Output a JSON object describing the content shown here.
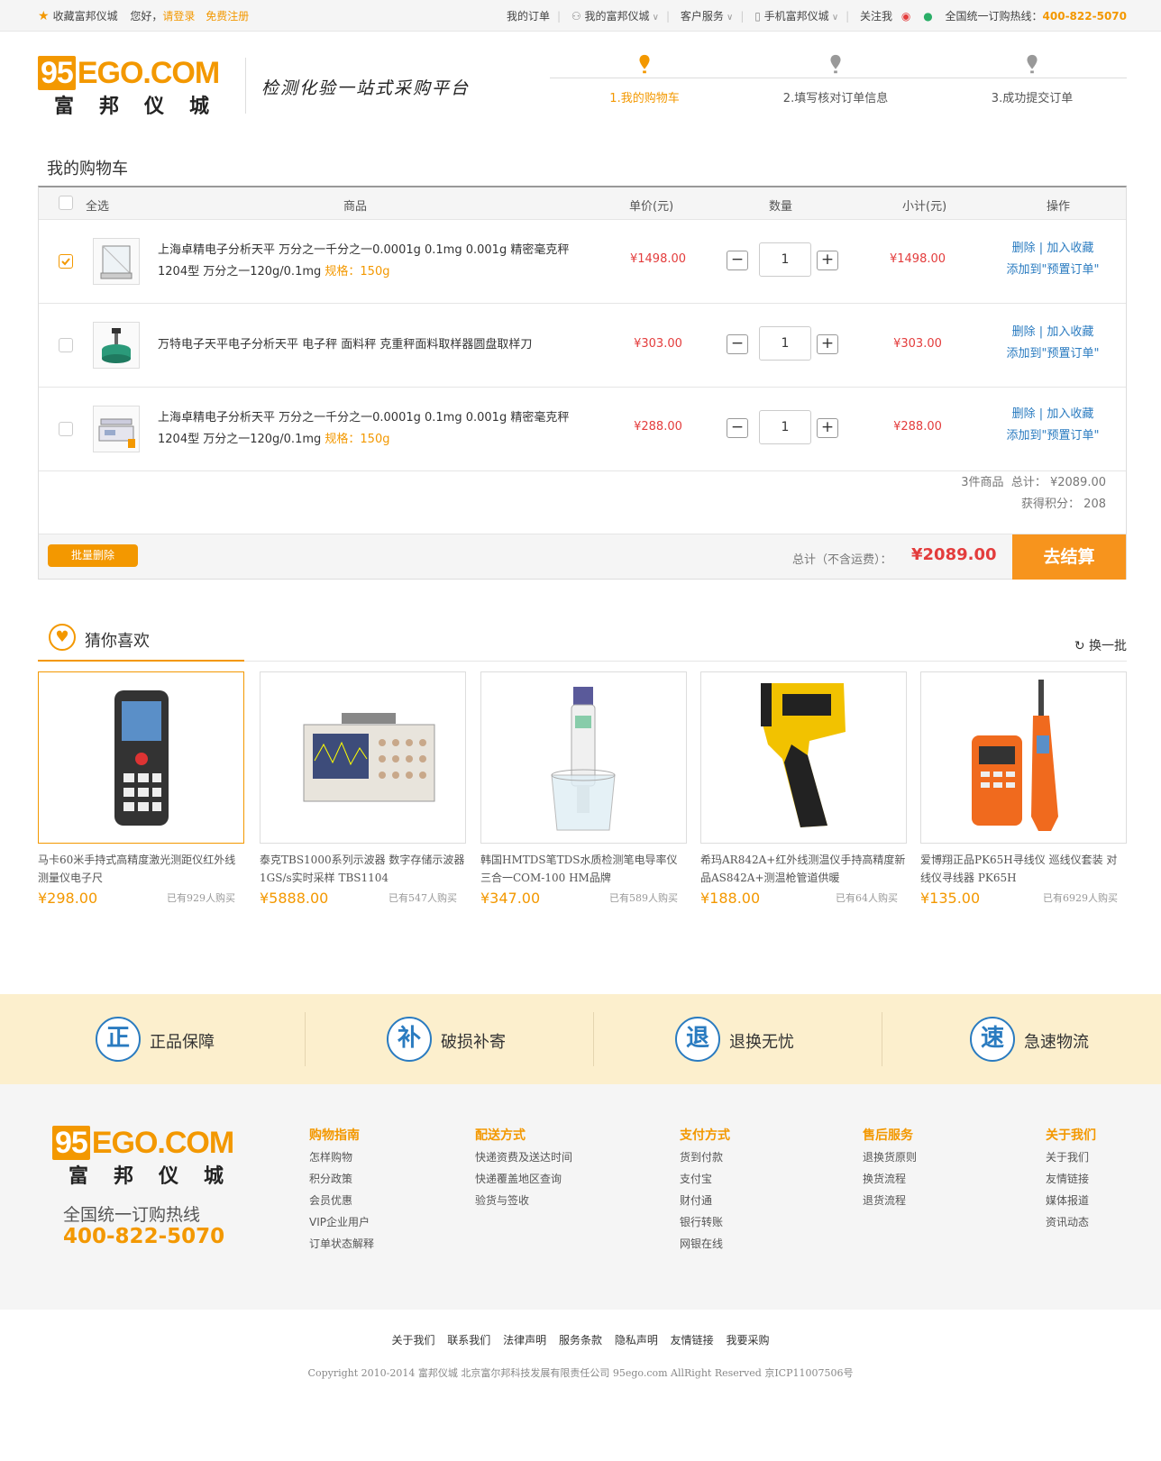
{
  "topbar": {
    "fav": "收藏富邦仪城",
    "hello": "您好，",
    "login": "请登录",
    "register": "免费注册",
    "nav": [
      "我的订单",
      "我的富邦仪城",
      "客户服务",
      "手机富邦仪城",
      "关注我"
    ],
    "hotline_label": "全国统一订购热线：",
    "hotline": "400-822-5070"
  },
  "header": {
    "logo_en": "95EGO.COM",
    "logo_n": "95",
    "logo_rest": "EGO.COM",
    "logo_cn": "富邦仪城",
    "slogan": "检测化验一站式采购平台",
    "steps": [
      "1.我的购物车",
      "2.填写核对订单信息",
      "3.成功提交订单"
    ]
  },
  "cart": {
    "title": "我的购物车",
    "headers": {
      "select_all": "全选",
      "product": "商品",
      "unit_price": "单价(元)",
      "qty": "数量",
      "subtotal": "小计(元)",
      "ops": "操作"
    },
    "items": [
      {
        "name": "上海卓精电子分析天平 万分之一千分之一0.0001g 0.1mg 0.001g 精密毫克秤 1204型 万分之一120g/0.1mg",
        "spec": "规格：150g",
        "price": "¥1498.00",
        "qty": "1",
        "subtotal": "¥1498.00",
        "checked": true
      },
      {
        "name": "万特电子天平电子分析天平 电子秤 面料秤 克重秤面料取样器圆盘取样刀",
        "spec": "",
        "price": "¥303.00",
        "qty": "1",
        "subtotal": "¥303.00",
        "checked": false
      },
      {
        "name": "上海卓精电子分析天平 万分之一千分之一0.0001g 0.1mg 0.001g 精密毫克秤 1204型 万分之一120g/0.1mg",
        "spec": "规格：150g",
        "price": "¥288.00",
        "qty": "1",
        "subtotal": "¥288.00",
        "checked": false
      }
    ],
    "ops": {
      "delete": "删除",
      "sep": "|",
      "fav": "加入收藏",
      "preset": "添加到\"预置订单\""
    },
    "summary": {
      "count": "3件商品",
      "total_lbl": "总计：",
      "total": "¥2089.00",
      "points_lbl": "获得积分：",
      "points": "208"
    },
    "batch_delete": "批量删除",
    "grand_lbl": "总计（不含运费）：",
    "grand": "¥2089.00",
    "checkout": "去结算"
  },
  "guess": {
    "title": "猜你喜欢",
    "refresh": "换一批",
    "items": [
      {
        "title": "马卡60米手持式高精度激光测距仪红外线测量仪电子尺",
        "price": "¥298.00",
        "bought": "已有929人购买"
      },
      {
        "title": "泰克TBS1000系列示波器 数字存储示波器1GS/s实时采样 TBS1104",
        "price": "¥5888.00",
        "bought": "已有547人购买"
      },
      {
        "title": "韩国HMTDS笔TDS水质检测笔电导率仪三合一COM-100 HM品牌",
        "price": "¥347.00",
        "bought": "已有589人购买"
      },
      {
        "title": "希玛AR842A+红外线测温仪手持高精度新品AS842A+测温枪管道供暖",
        "price": "¥188.00",
        "bought": "已有64人购买"
      },
      {
        "title": "爱博翔正品PK65H寻线仪 巡线仪套装 对线仪寻线器 PK65H",
        "price": "¥135.00",
        "bought": "已有6929人购买"
      }
    ]
  },
  "guarantee": [
    {
      "icon": "正",
      "label": "正品保障"
    },
    {
      "icon": "补",
      "label": "破损补寄"
    },
    {
      "icon": "退",
      "label": "退换无忧"
    },
    {
      "icon": "速",
      "label": "急速物流"
    }
  ],
  "footer": {
    "hotline_lbl": "全国统一订购热线",
    "hotline": "400-822-5070",
    "cols": [
      {
        "h": "购物指南",
        "items": [
          "怎样购物",
          "积分政策",
          "会员优惠",
          "VIP企业用户",
          "订单状态解释"
        ]
      },
      {
        "h": "配送方式",
        "items": [
          "快递资费及送达时间",
          "快递覆盖地区查询",
          "验货与签收"
        ]
      },
      {
        "h": "支付方式",
        "items": [
          "货到付款",
          "支付宝",
          "财付通",
          "银行转账",
          "网银在线"
        ]
      },
      {
        "h": "售后服务",
        "items": [
          "退换货原则",
          "换货流程",
          "退货流程"
        ]
      },
      {
        "h": "关于我们",
        "items": [
          "关于我们",
          "友情链接",
          "媒体报道",
          "资讯动态"
        ]
      }
    ],
    "links": [
      "关于我们",
      "联系我们",
      "法律声明",
      "服务条款",
      "隐私声明",
      "友情链接",
      "我要采购"
    ],
    "copyright": "Copyright 2010-2014 富邦仪城  北京富尔邦科技发展有限责任公司 95ego.com  AllRight Reserved 京ICP11007506号"
  },
  "colors": {
    "accent": "#f39800",
    "price": "#e33c3c",
    "link": "#2a7bc0"
  }
}
